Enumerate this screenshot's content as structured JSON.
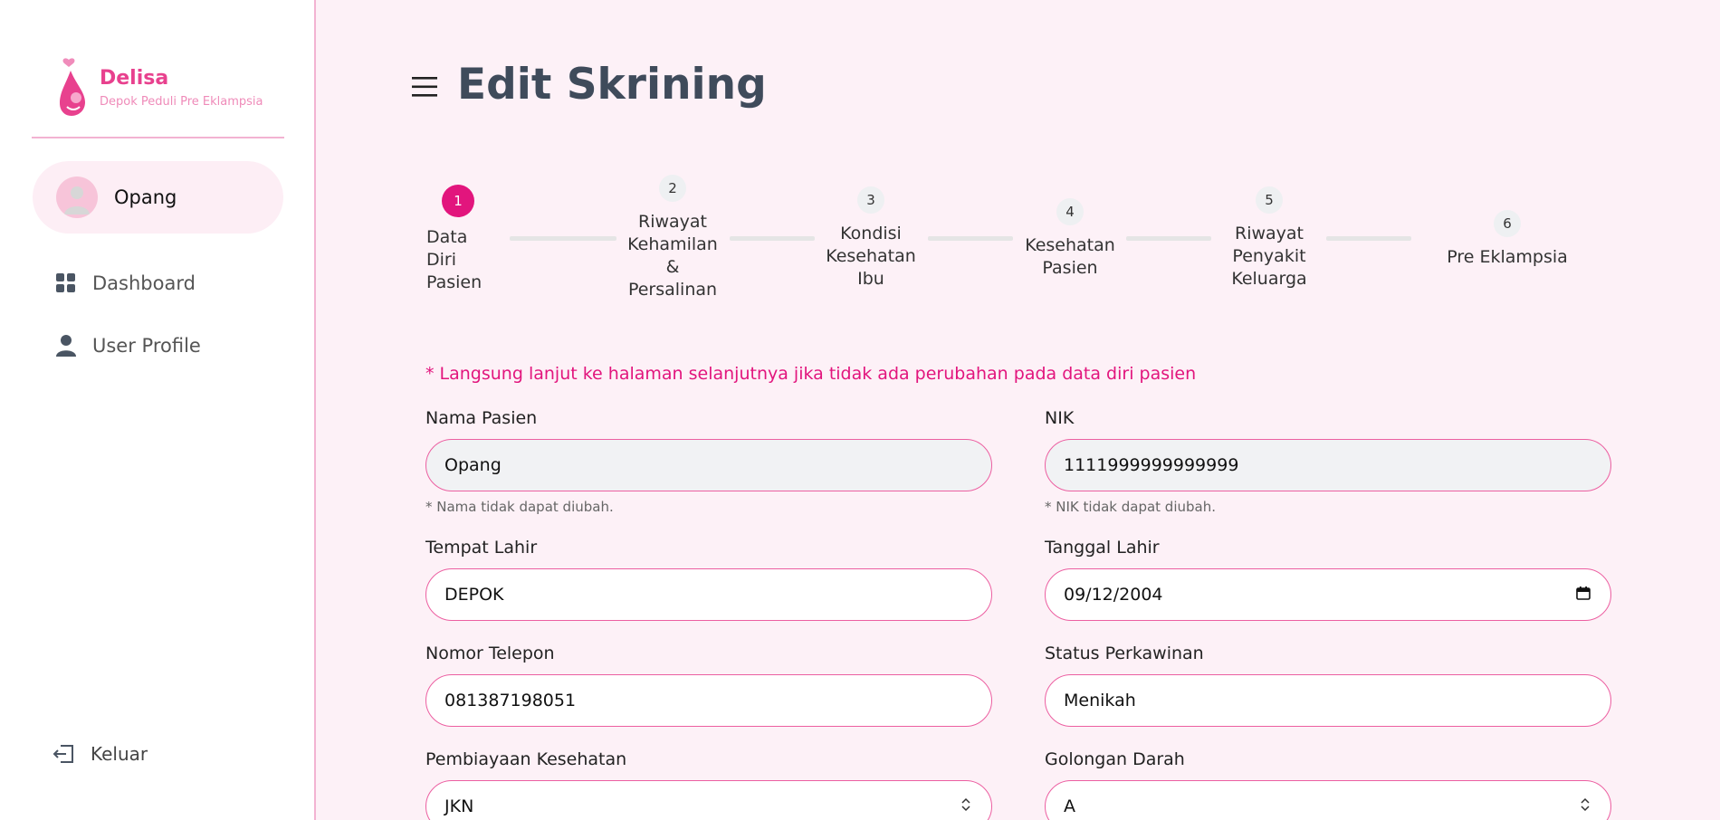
{
  "brand": {
    "name": "Delisa",
    "subtitle": "Depok Peduli Pre Eklampsia",
    "accent": "#e8418e"
  },
  "user": {
    "name": "Opang"
  },
  "nav": [
    {
      "label": "Dashboard",
      "icon": "dashboard-icon"
    },
    {
      "label": "User Profile",
      "icon": "user-icon"
    }
  ],
  "logout": {
    "label": "Keluar",
    "icon": "logout-icon"
  },
  "page": {
    "title": "Edit Skrining"
  },
  "steps": [
    {
      "num": "1",
      "label": "Data Diri Pasien",
      "active": true
    },
    {
      "num": "2",
      "label": "Riwayat Kehamilan & Persalinan",
      "active": false
    },
    {
      "num": "3",
      "label": "Kondisi Kesehatan Ibu",
      "active": false
    },
    {
      "num": "4",
      "label": "Kesehatan Pasien",
      "active": false
    },
    {
      "num": "5",
      "label": "Riwayat Penyakit Keluarga",
      "active": false
    },
    {
      "num": "6",
      "label": "Pre Eklampsia",
      "active": false
    }
  ],
  "form": {
    "notice": "* Langsung lanjut ke halaman selanjutnya jika tidak ada perubahan pada data diri pasien",
    "nama": {
      "label": "Nama Pasien",
      "value": "Opang",
      "hint": "* Nama tidak dapat diubah."
    },
    "nik": {
      "label": "NIK",
      "value": "1111999999999999",
      "hint": "* NIK tidak dapat diubah."
    },
    "tempat_lahir": {
      "label": "Tempat Lahir",
      "value": "DEPOK"
    },
    "tanggal_lahir": {
      "label": "Tanggal Lahir",
      "value": "09/12/2004"
    },
    "telepon": {
      "label": "Nomor Telepon",
      "value": "081387198051"
    },
    "status": {
      "label": "Status Perkawinan",
      "value": "Menikah"
    },
    "pembiayaan": {
      "label": "Pembiayaan Kesehatan",
      "value": "JKN"
    },
    "golongan_darah": {
      "label": "Golongan Darah",
      "value": "A"
    }
  }
}
